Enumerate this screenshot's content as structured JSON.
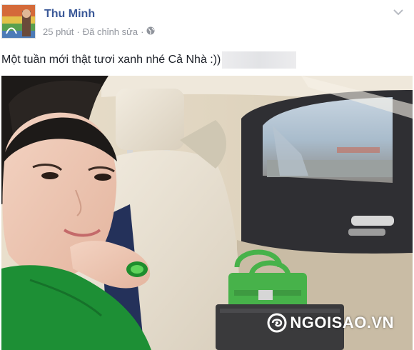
{
  "post": {
    "author_name": "Thu Minh",
    "time": "25 phút",
    "separator": "·",
    "edited": "Đã chỉnh sửa",
    "privacy_icon": "globe-icon",
    "options_icon": "chevron-down-icon",
    "message": "Một tuần mới thật tươi xanh nhé Cả Nhà :))"
  },
  "photo": {
    "watermark": "NGOISAO.VN",
    "watermark_logo_icon": "swirl-logo-icon"
  },
  "colors": {
    "author": "#3b5998",
    "meta": "#90949c",
    "shirt_green": "#1d8f35",
    "bag_green": "#47b24a"
  }
}
